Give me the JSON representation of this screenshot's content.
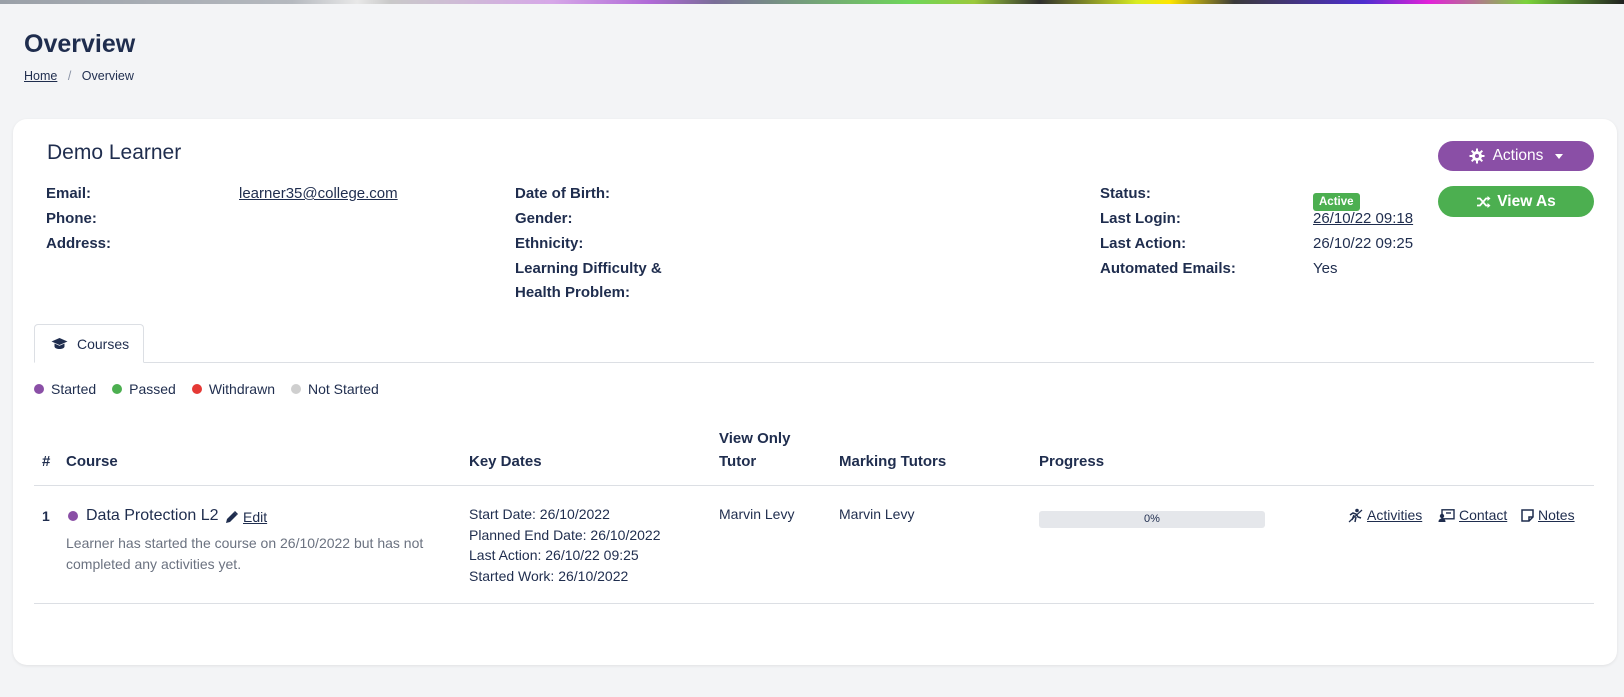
{
  "page": {
    "title": "Overview",
    "breadcrumb": {
      "home": "Home",
      "separator": "/",
      "current": "Overview"
    }
  },
  "learner": {
    "name": "Demo Learner",
    "fields": {
      "email_label": "Email:",
      "email_value": "learner35@college.com",
      "phone_label": "Phone:",
      "address_label": "Address:",
      "dob_label": "Date of Birth:",
      "gender_label": "Gender:",
      "ethnicity_label": "Ethnicity:",
      "ldd_label_1": "Learning Difficulty &",
      "ldd_label_2": "Health Problem:",
      "status_label": "Status:",
      "status_value": "Active",
      "last_login_label": "Last Login:",
      "last_login_value": "26/10/22 09:18",
      "last_action_label": "Last Action:",
      "last_action_value": "26/10/22 09:25",
      "auto_emails_label": "Automated Emails:",
      "auto_emails_value": "Yes"
    },
    "buttons": {
      "actions": "Actions",
      "view_as": "View As"
    }
  },
  "tabs": [
    {
      "label": "Courses",
      "icon": "graduation-cap-icon",
      "active": true
    }
  ],
  "legend": [
    {
      "label": "Started",
      "color": "#8a4fa6"
    },
    {
      "label": "Passed",
      "color": "#4caf50"
    },
    {
      "label": "Withdrawn",
      "color": "#e53935"
    },
    {
      "label": "Not Started",
      "color": "#cfcfcf"
    }
  ],
  "table": {
    "headers": {
      "index": "#",
      "course": "Course",
      "key_dates": "Key Dates",
      "view_only_tutor_1": "View Only",
      "view_only_tutor_2": "Tutor",
      "marking_tutors": "Marking Tutors",
      "progress": "Progress"
    },
    "rows": [
      {
        "index": "1",
        "course": "Data Protection L2",
        "status_color": "#8a4fa6",
        "edit": "Edit",
        "description": "Learner has started the course on 26/10/2022 but has not completed any activities yet.",
        "start_date": "Start Date: 26/10/2022",
        "planned_end_date": "Planned End Date: 26/10/2022",
        "last_action": "Last Action: 26/10/22 09:25",
        "started_work": "Started Work: 26/10/2022",
        "view_only_tutor": "Marvin Levy",
        "marking_tutors": "Marvin Levy",
        "progress_percent": 0,
        "progress_label": "0%",
        "actions": {
          "activities": "Activities",
          "contact": "Contact",
          "notes": "Notes"
        }
      }
    ]
  },
  "colors": {
    "primary_text": "#1f2d4e",
    "purple": "#8a4fa6",
    "green": "#4caf50"
  }
}
